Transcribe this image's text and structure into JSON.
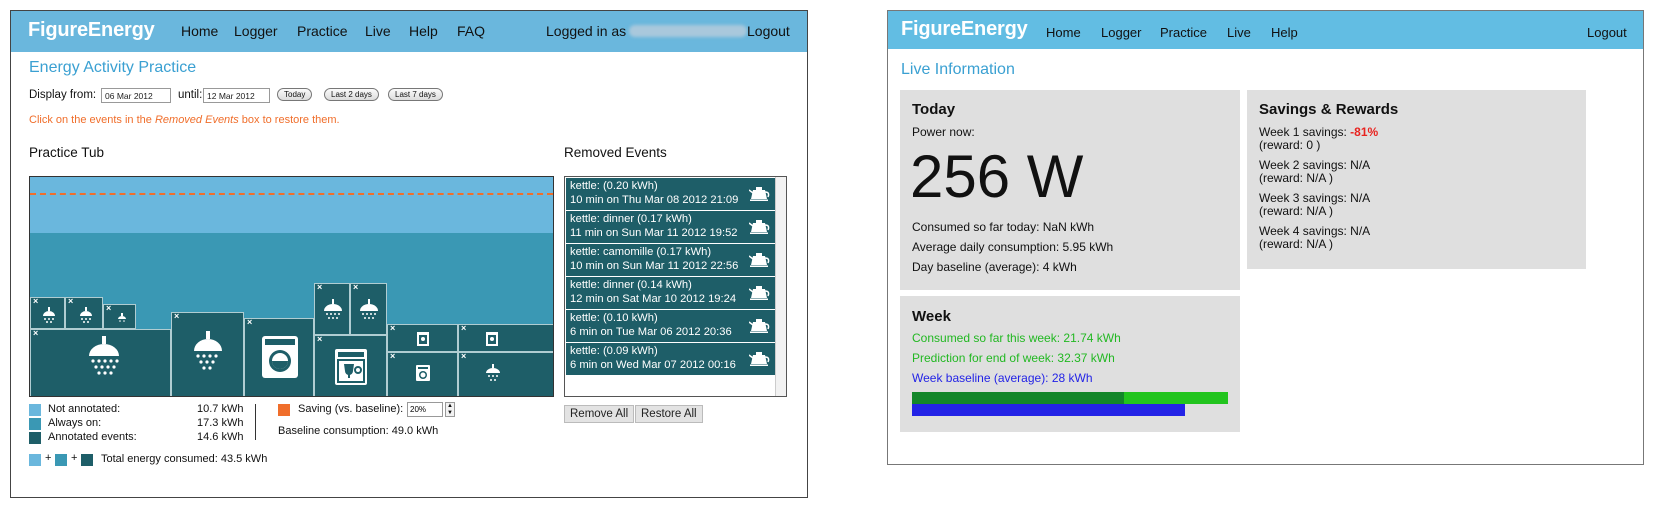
{
  "left": {
    "brand": "FigureEnergy",
    "nav": [
      "Home",
      "Logger",
      "Practice",
      "Live",
      "Help",
      "FAQ"
    ],
    "logged_in_label": "Logged in as",
    "logout": "Logout",
    "title": "Energy Activity Practice",
    "display_from_label": "Display from:",
    "from_value": "06 Mar 2012",
    "until_label": "until:",
    "until_value": "12 Mar 2012",
    "range_buttons": [
      "Today",
      "Last 2 days",
      "Last 7 days"
    ],
    "hint_prefix": "Click on the events in the ",
    "hint_emph": "Removed Events",
    "hint_suffix": " box to restore them.",
    "tub_title": "Practice Tub",
    "removed_title": "Removed Events",
    "removed_events": [
      {
        "line1": "kettle: (0.20 kWh)",
        "line2": "10 min on Thu Mar 08 2012 21:09"
      },
      {
        "line1": "kettle: dinner (0.17 kWh)",
        "line2": "11 min on Sun Mar 11 2012 19:52"
      },
      {
        "line1": "kettle: camomille (0.17 kWh)",
        "line2": "10 min on Sun Mar 11 2012 22:56"
      },
      {
        "line1": "kettle: dinner (0.14 kWh)",
        "line2": "12 min on Sat Mar 10 2012 19:24"
      },
      {
        "line1": "kettle: (0.10 kWh)",
        "line2": "6 min on Tue Mar 06 2012 20:36"
      },
      {
        "line1": "kettle: (0.09 kWh)",
        "line2": "6 min on Wed Mar 07 2012 00:16"
      }
    ],
    "legend": {
      "not_annotated_label": "Not annotated:",
      "not_annotated_value": "10.7 kWh",
      "always_on_label": "Always on:",
      "always_on_value": "17.3 kWh",
      "annotated_label": "Annotated events:",
      "annotated_value": "14.6 kWh",
      "plus": "+",
      "total_label": "Total energy consumed: 43.5 kWh",
      "saving_label": "Saving (vs. baseline):",
      "saving_value": "20%",
      "baseline_label": "Baseline consumption: 49.0 kWh"
    },
    "remove_all": "Remove All",
    "restore_all": "Restore All",
    "colors": {
      "not_annotated": "#6ab7dd",
      "always_on": "#3a98b4",
      "annotated": "#1e5e68",
      "saving": "#f06e2b"
    }
  },
  "right": {
    "brand": "FigureEnergy",
    "nav": [
      "Home",
      "Logger",
      "Practice",
      "Live",
      "Help"
    ],
    "logout": "Logout",
    "title": "Live Information",
    "today": {
      "title": "Today",
      "power_label": "Power now:",
      "power_value": "256 W",
      "consumed": "Consumed so far today: NaN kWh",
      "avg": "Average daily consumption: 5.95 kWh",
      "baseline": "Day baseline (average): 4 kWh"
    },
    "savings": {
      "title": "Savings & Rewards",
      "weeks": [
        {
          "label": "Week 1 savings: ",
          "value": "-81%",
          "reward": "(reward: 0 )"
        },
        {
          "label": "Week 2 savings: ",
          "value": "N/A",
          "reward": "(reward: N/A )"
        },
        {
          "label": "Week 3 savings: ",
          "value": "N/A",
          "reward": "(reward: N/A )"
        },
        {
          "label": "Week 4 savings: ",
          "value": "N/A",
          "reward": "(reward: N/A )"
        }
      ]
    },
    "week": {
      "title": "Week",
      "consumed": "Consumed so far this week: 21.74 kWh",
      "prediction": "Prediction for end of week: 32.37 kWh",
      "baseline": "Week baseline (average): 28 kWh",
      "consumed_kwh": 21.74,
      "prediction_kwh": 32.37,
      "baseline_kwh": 28
    },
    "colors": {
      "green": "#22b822",
      "dark_green": "#13862a",
      "blue": "#2323e6",
      "red": "#e8231f"
    }
  }
}
